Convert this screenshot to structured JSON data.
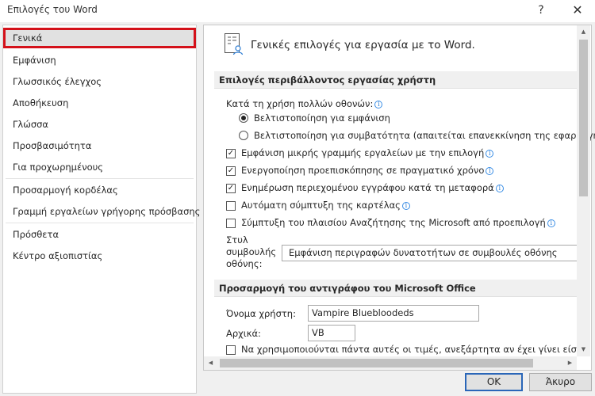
{
  "window": {
    "title": "Επιλογές του Word",
    "help_label": "?",
    "close_label": "✕"
  },
  "sidebar": {
    "items": [
      {
        "label": "Γενικά",
        "selected": true
      },
      {
        "label": "Εμφάνιση"
      },
      {
        "label": "Γλωσσικός έλεγχος"
      },
      {
        "label": "Αποθήκευση"
      },
      {
        "label": "Γλώσσα"
      },
      {
        "label": "Προσβασιμότητα"
      },
      {
        "label": "Για προχωρημένους"
      },
      {
        "label": "Προσαρμογή κορδέλας"
      },
      {
        "label": "Γραμμή εργαλείων γρήγορης πρόσβασης"
      },
      {
        "label": "Πρόσθετα"
      },
      {
        "label": "Κέντρο αξιοπιστίας"
      }
    ]
  },
  "content": {
    "intro": "Γενικές επιλογές για εργασία με το Word.",
    "section_ui": "Επιλογές περιβάλλοντος εργασίας χρήστη",
    "multi_display_label": "Κατά τη χρήση πολλών οθονών:",
    "radio_optimize_appearance": "Βελτιστοποίηση για εμφάνιση",
    "radio_optimize_compat": "Βελτιστοποίηση για συμβατότητα (απαιτείται επανεκκίνηση της εφαρμογής)",
    "checkboxes": [
      {
        "label": "Εμφάνιση μικρής γραμμής εργαλείων με την επιλογή",
        "checked": true,
        "info": true
      },
      {
        "label": "Ενεργοποίηση προεπισκόπησης σε πραγματικό χρόνο",
        "checked": true,
        "info": true
      },
      {
        "label": "Ενημέρωση περιεχομένου εγγράφου κατά τη μεταφορά",
        "checked": true,
        "info": true
      },
      {
        "label": "Αυτόματη σύμπτυξη της καρτέλας",
        "checked": false,
        "info": true
      },
      {
        "label": "Σύμπτυξη του πλαισίου Αναζήτησης της Microsoft από προεπιλογή",
        "checked": false,
        "info": true
      }
    ],
    "screentip_label_1": "Στυλ",
    "screentip_label_2": "συμβουλής",
    "screentip_label_3": "οθόνης:",
    "screentip_value": "Εμφάνιση περιγραφών δυνατοτήτων σε συμβουλές οθόνης",
    "section_personalize": "Προσαρμογή του αντιγράφου του Microsoft Office",
    "username_label": "Όνομα χρήστη:",
    "username_value": "Vampire Bluebloodeds",
    "initials_label": "Αρχικά:",
    "initials_value": "VB",
    "always_use_label": "Να χρησιμοποιούνται πάντα αυτές οι τιμές, ανεξάρτητα αν έχει γίνει είσοδος στο Office."
  },
  "buttons": {
    "ok": "OK",
    "cancel": "Άκυρο"
  },
  "colors": {
    "accent": "#2a66b8",
    "highlight": "#d4111a",
    "info": "#2b7cd3"
  }
}
